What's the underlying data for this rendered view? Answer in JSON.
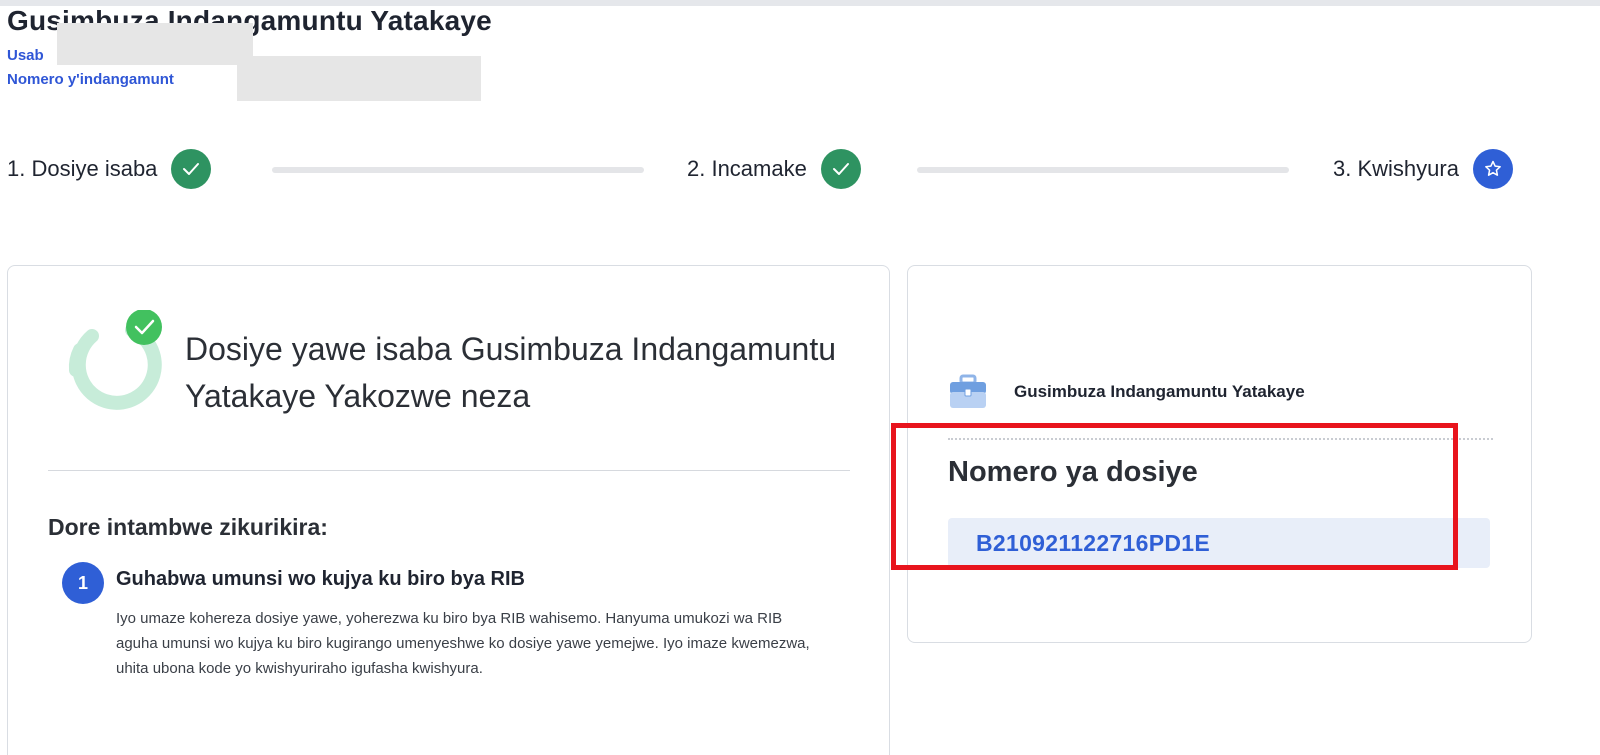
{
  "header": {
    "title": "Gusimbuza Indangamuntu Yatakaye",
    "applicant_label": "Usab",
    "id_number_label": "Nomero y'indangamunt"
  },
  "stepper": {
    "steps": [
      {
        "label": "1. Dosiye isaba",
        "status": "done",
        "icon": "check-icon"
      },
      {
        "label": "2. Incamake",
        "status": "done",
        "icon": "check-icon"
      },
      {
        "label": "3. Kwishyura",
        "status": "current",
        "icon": "star-icon"
      }
    ]
  },
  "success_card": {
    "title": "Dosiye yawe isaba Gusimbuza Indangamuntu Yatakaye Yakozwe neza",
    "next_steps_heading": "Dore intambwe zikurikira:",
    "steps": [
      {
        "number": "1",
        "title": "Guhabwa umunsi wo kujya ku biro bya RIB",
        "description": "Iyo umaze kohereza dosiye yawe, yoherezwa ku biro bya RIB wahisemo. Hanyuma umukozi wa RIB aguha umunsi wo kujya ku biro kugirango umenyeshwe ko dosiye yawe yemejwe. Iyo imaze kwemezwa, uhita ubona kode yo kwishyuriraho igufasha kwishyura."
      }
    ]
  },
  "summary_card": {
    "service_icon": "briefcase-icon",
    "service_name": "Gusimbuza Indangamuntu Yatakaye",
    "file_number_label": "Nomero ya dosiye",
    "file_number": "B210921122716PD1E"
  },
  "colors": {
    "accent": "#2f5fd6",
    "success": "#2e9361",
    "highlight": "#e8141d"
  }
}
